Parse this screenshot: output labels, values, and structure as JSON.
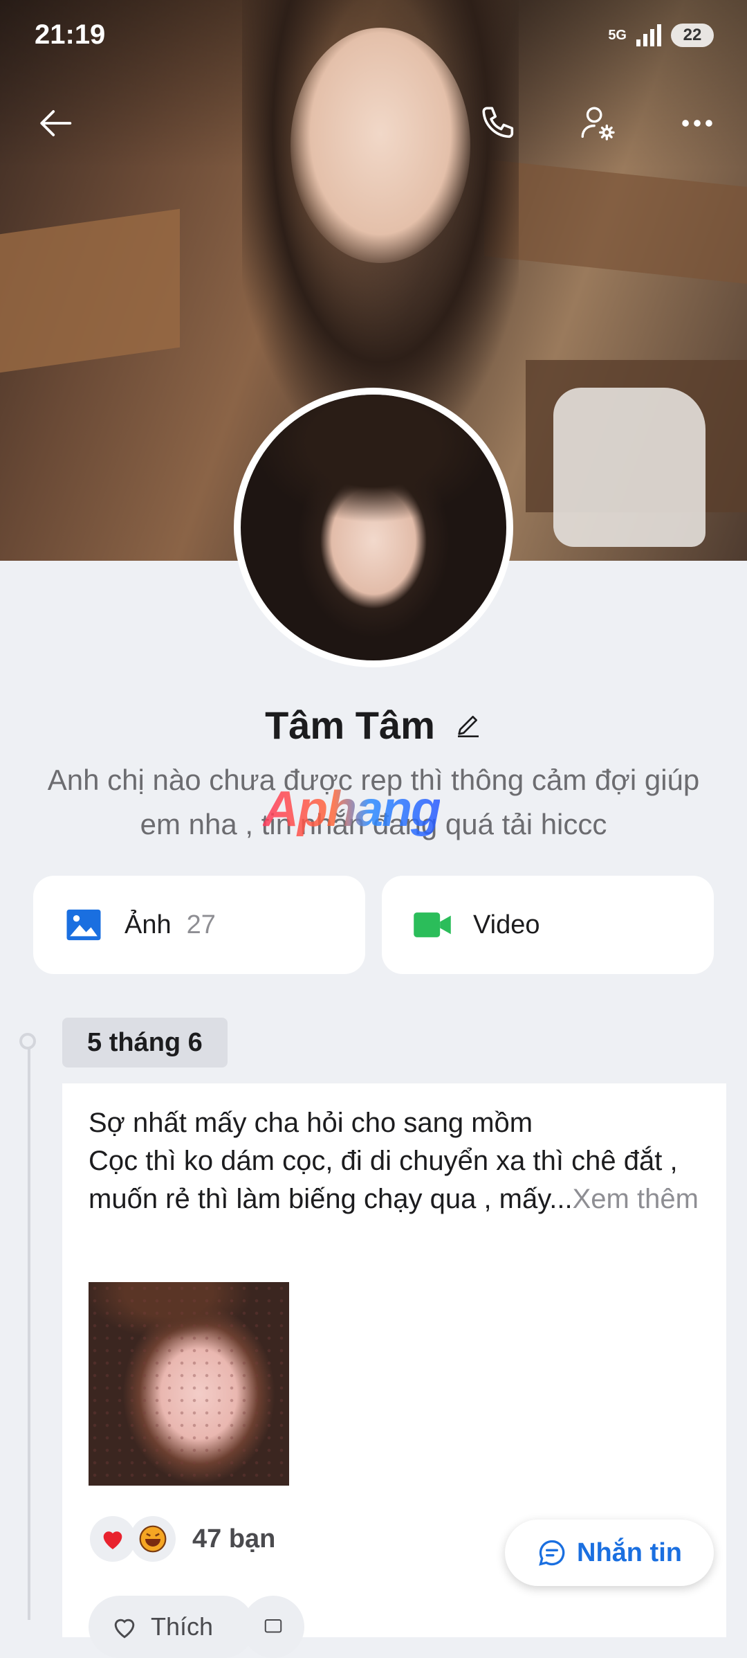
{
  "status_bar": {
    "time": "21:19",
    "network": "5G",
    "battery": "22"
  },
  "profile": {
    "name": "Tâm Tâm",
    "bio": "Anh chị nào chưa được rep thì thông cảm đợi giúp em nha , tin nhắn đang quá tải hiccc"
  },
  "media": {
    "photos_label": "Ảnh",
    "photos_count": "27",
    "video_label": "Video"
  },
  "feed": {
    "date": "5 tháng 6",
    "post_text": "Sợ nhất mấy cha hỏi cho sang mồm\nCọc thì ko dám cọc, đi di chuyển xa thì chê đắt , muốn rẻ thì làm biếng chạy qua , mấy...",
    "see_more": "Xem thêm",
    "reaction_count": "47 bạn",
    "like_label": "Thích"
  },
  "fab": {
    "label": "Nhắn tin"
  },
  "watermark": "Aphang",
  "colors": {
    "accent": "#1a6fe0",
    "photo_icon": "#1a6fe0",
    "video_icon": "#2bbd5a",
    "background": "#eef0f4"
  },
  "icons": {
    "back": "arrow-left-icon",
    "call": "phone-icon",
    "settings": "user-gear-icon",
    "more": "more-dots-icon",
    "edit": "pencil-icon",
    "photo": "image-icon",
    "video": "video-camera-icon",
    "message": "chat-bubble-icon"
  }
}
